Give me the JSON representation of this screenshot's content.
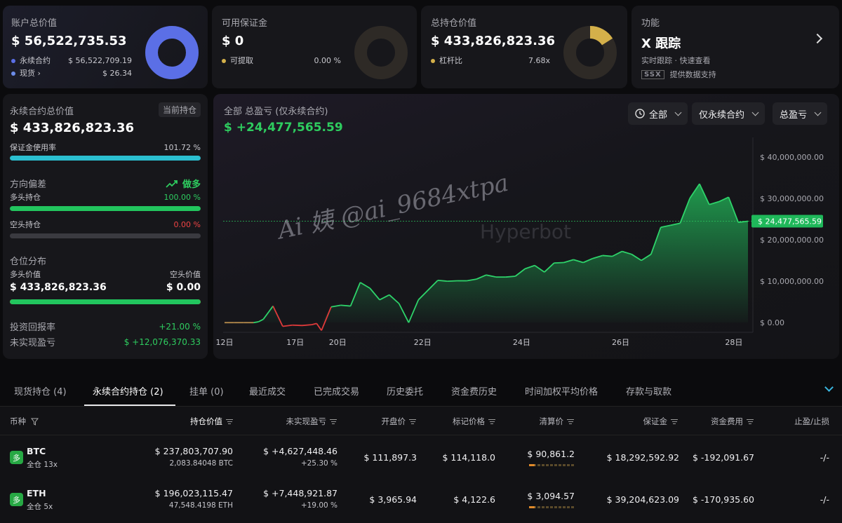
{
  "account": {
    "label": "账户总价值",
    "value": "$ 56,522,735.53",
    "perp_label": "永续合约",
    "perp_value": "$ 56,522,709.19",
    "spot_label": "现货",
    "spot_value": "$ 26.34",
    "ring_fill": 0.999,
    "color": "#5b6fe6"
  },
  "margin": {
    "label": "可用保证金",
    "value": "$ 0",
    "withdraw_label": "可提取",
    "withdraw_value": "0.00 %",
    "ring_fill": 0.0,
    "color": "#d4b04a"
  },
  "position": {
    "label": "总持仓价值",
    "value": "$ 433,826,823.36",
    "leverage_label": "杠杆比",
    "leverage_value": "7.68x",
    "ring_fill": 0.16,
    "color": "#d4b04a"
  },
  "feature": {
    "label": "功能",
    "title": "X 跟踪",
    "desc": "实时跟踪 · 快速查看",
    "provider_logo": "SSX",
    "provider_text": "提供数据支持"
  },
  "perp_panel": {
    "title": "永续合约总价值",
    "tag": "当前持仓",
    "value": "$ 433,826,823.36",
    "margin_usage_label": "保证金使用率",
    "margin_usage_value": "101.72 %",
    "margin_usage_fill": 1.0,
    "direction_label": "方向偏差",
    "direction_value": "做多",
    "long_label": "多头持仓",
    "long_value": "100.00 %",
    "long_fill": 1.0,
    "short_label": "空头持仓",
    "short_value": "0.00 %",
    "short_fill": 0.0,
    "dist_label": "仓位分布",
    "long_val_label": "多头价值",
    "short_val_label": "空头价值",
    "long_val": "$ 433,826,823.36",
    "short_val": "$ 0.00",
    "dist_fill": 1.0,
    "roi_label": "投资回报率",
    "roi_value": "+21.00 %",
    "upnl_label": "未实现盈亏",
    "upnl_value": "$ +12,076,370.33"
  },
  "pnl_panel": {
    "title": "全部 总盈亏 (仅永续合约)",
    "value": "$ +24,477,565.59",
    "filter_all": "全部",
    "filter_perp": "仅永续合约",
    "filter_pnl": "总盈亏",
    "current_label": "$ 24,477,565.59",
    "watermark_user": "Ai 姨 @ai_9684xtpa",
    "watermark_brand": "Hyperbot"
  },
  "chart_data": {
    "type": "area",
    "ylim": [
      -2000000,
      42000000
    ],
    "y_ticks": [
      0,
      10000000,
      20000000,
      30000000,
      40000000
    ],
    "y_tick_labels": [
      "$ 0.00",
      "$ 10,000,000.00",
      "$ 20,000,000.00",
      "$ 30,000,000.00",
      "$ 40,000,000.00"
    ],
    "x_tick_positions": [
      0,
      5,
      8,
      14,
      21,
      28,
      36
    ],
    "x_tick_labels": [
      "12日",
      "17日",
      "20日",
      "22日",
      "24日",
      "26日",
      "28日"
    ],
    "x_range": [
      0,
      37
    ],
    "current_value": 24477565.59,
    "series": [
      {
        "name": "",
        "points": [
          [
            0,
            0
          ],
          [
            1,
            0
          ],
          [
            2,
            0
          ],
          [
            3,
            0
          ],
          [
            3.5,
            200000
          ],
          [
            4,
            800000
          ],
          [
            5,
            4000000
          ],
          [
            6,
            -900000
          ],
          [
            7,
            -600000
          ],
          [
            8,
            -700000
          ],
          [
            9,
            -500000
          ],
          [
            9.5,
            -200000
          ],
          [
            10,
            -1900000
          ],
          [
            11,
            3800000
          ],
          [
            12,
            4200000
          ],
          [
            13,
            4000000
          ],
          [
            14,
            9700000
          ],
          [
            15,
            8300000
          ],
          [
            16,
            5500000
          ],
          [
            17,
            6700000
          ],
          [
            18,
            4600000
          ],
          [
            19,
            0
          ],
          [
            20,
            5500000
          ],
          [
            22,
            10200000
          ],
          [
            23,
            10000000
          ],
          [
            24,
            10100000
          ],
          [
            25,
            10100000
          ],
          [
            26,
            10500000
          ],
          [
            27,
            11500000
          ],
          [
            28,
            11000000
          ],
          [
            29,
            11000000
          ],
          [
            30,
            11200000
          ],
          [
            31,
            13000000
          ],
          [
            32,
            13800000
          ],
          [
            33,
            12200000
          ],
          [
            34,
            14400000
          ],
          [
            35,
            14500000
          ],
          [
            36,
            15200000
          ],
          [
            37,
            14500000
          ],
          [
            38,
            15500000
          ],
          [
            39,
            16200000
          ],
          [
            40,
            16000000
          ],
          [
            41,
            17200000
          ],
          [
            42,
            16500000
          ],
          [
            43,
            15000000
          ],
          [
            44,
            16500000
          ],
          [
            45,
            23000000
          ],
          [
            46,
            23500000
          ],
          [
            47,
            24000000
          ],
          [
            48,
            30000000
          ],
          [
            49,
            33500000
          ],
          [
            50,
            28500000
          ],
          [
            51,
            29200000
          ],
          [
            52,
            30300000
          ],
          [
            53,
            24200000
          ],
          [
            54,
            24477565
          ]
        ]
      }
    ]
  },
  "tabs": [
    {
      "label": "现货持仓 (4)",
      "active": false
    },
    {
      "label": "永续合约持仓 (2)",
      "active": true
    },
    {
      "label": "挂单 (0)",
      "active": false
    },
    {
      "label": "最近成交",
      "active": false
    },
    {
      "label": "已完成交易",
      "active": false
    },
    {
      "label": "历史委托",
      "active": false
    },
    {
      "label": "资金费历史",
      "active": false
    },
    {
      "label": "时间加权平均价格",
      "active": false
    },
    {
      "label": "存款与取款",
      "active": false
    }
  ],
  "table": {
    "headers": {
      "coin": "币种",
      "value": "持仓价值",
      "upnl": "未实现盈亏",
      "entry": "开盘价",
      "mark": "标记价格",
      "liq": "清算价",
      "margin": "保证金",
      "funding": "资金费用",
      "tpsl": "止盈/止损"
    },
    "rows": [
      {
        "badge": "多",
        "coin": "BTC",
        "mode": "全仓 13x",
        "value": "$ 237,803,707.90",
        "size": "2,083.84048 BTC",
        "upnl": "$ +4,627,448.46",
        "upnl_pct": "+25.30 %",
        "entry": "$ 111,897.3",
        "mark": "$ 114,118.0",
        "liq": "$ 90,861.2",
        "margin": "$ 18,292,592.92",
        "funding": "$ -192,091.67",
        "tpsl": "-/-"
      },
      {
        "badge": "多",
        "coin": "ETH",
        "mode": "全仓 5x",
        "value": "$ 196,023,115.47",
        "size": "47,548.4198 ETH",
        "upnl": "$ +7,448,921.87",
        "upnl_pct": "+19.00 %",
        "entry": "$ 3,965.94",
        "mark": "$ 4,122.6",
        "liq": "$ 3,094.57",
        "margin": "$ 39,204,623.09",
        "funding": "$ -170,935.60",
        "tpsl": "-/-"
      }
    ]
  }
}
